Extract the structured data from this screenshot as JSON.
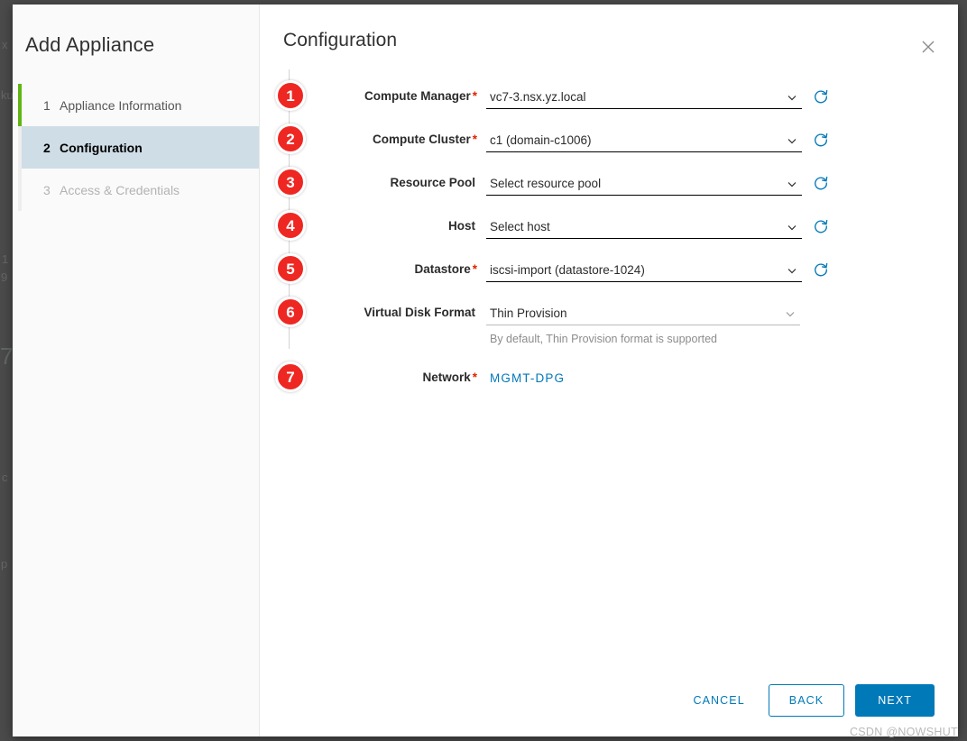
{
  "wizard": {
    "title": "Add Appliance",
    "steps": [
      {
        "num": "1",
        "label": "Appliance Information",
        "state": "done"
      },
      {
        "num": "2",
        "label": "Configuration",
        "state": "current"
      },
      {
        "num": "3",
        "label": "Access & Credentials",
        "state": "disabled"
      }
    ]
  },
  "header": {
    "page_title": "Configuration",
    "close_icon": "close-icon"
  },
  "form": {
    "fields": [
      {
        "badge": "1",
        "label": "Compute Manager",
        "required": "*",
        "value": "vc7-3.nsx.yz.local",
        "control": "select",
        "has_refresh": true
      },
      {
        "badge": "2",
        "label": "Compute Cluster",
        "required": "*",
        "value": "c1 (domain-c1006)",
        "control": "select",
        "has_refresh": true
      },
      {
        "badge": "3",
        "label": "Resource Pool",
        "required": "",
        "value": "Select resource pool",
        "control": "select",
        "has_refresh": true
      },
      {
        "badge": "4",
        "label": "Host",
        "required": "",
        "value": "Select host",
        "control": "select",
        "has_refresh": true
      },
      {
        "badge": "5",
        "label": "Datastore",
        "required": "*",
        "value": "iscsi-import (datastore-1024)",
        "control": "select",
        "has_refresh": true
      },
      {
        "badge": "6",
        "label": "Virtual Disk Format",
        "required": "",
        "value": "Thin Provision",
        "control": "select-light",
        "has_refresh": false,
        "hint": "By default, Thin Provision format is supported"
      },
      {
        "badge": "7",
        "label": "Network",
        "required": "*",
        "value": "MGMT-DPG",
        "control": "link",
        "has_refresh": false
      }
    ]
  },
  "footer": {
    "cancel_label": "CANCEL",
    "back_label": "BACK",
    "next_label": "NEXT"
  },
  "watermark": "CSDN @NOWSHUT",
  "backdrop_fragments": [
    "x",
    "ku",
    "1",
    "9",
    "7",
    "c",
    "p"
  ],
  "colors": {
    "accent_blue": "#0079b8",
    "badge_red": "#ee2722",
    "required_red": "#e02200",
    "step_done_green": "#60b515",
    "step_current_bg": "#cedde6",
    "link_blue": "#0079b8"
  }
}
